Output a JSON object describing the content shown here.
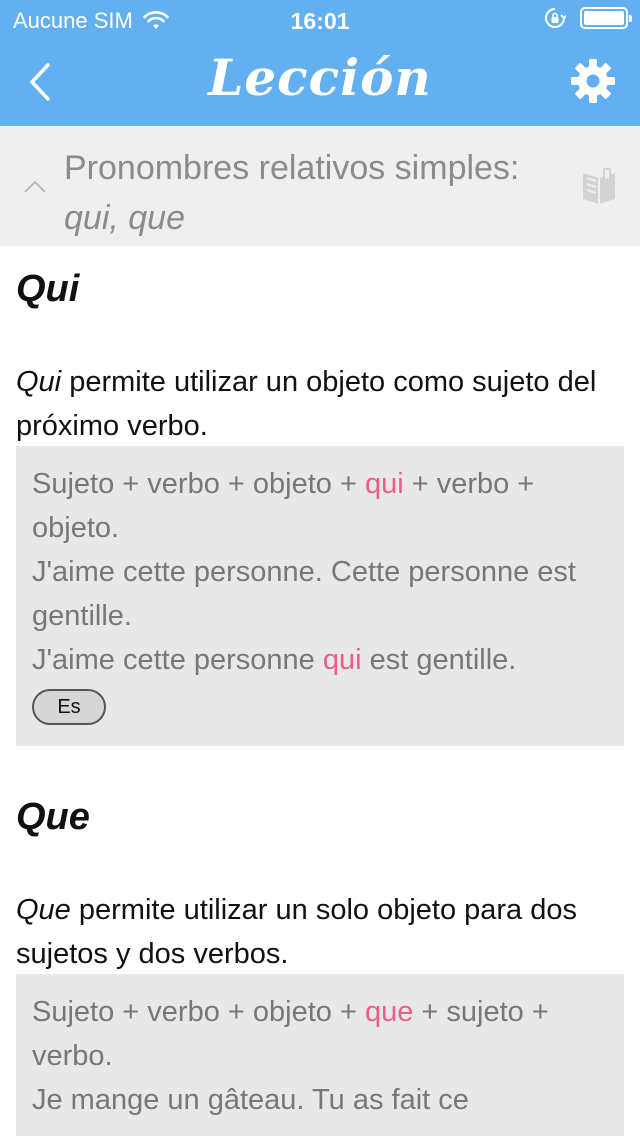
{
  "status_bar": {
    "carrier": "Aucune SIM",
    "time": "16:01"
  },
  "nav": {
    "title": "Lección"
  },
  "section": {
    "title_plain": "Pronombres relativos simples: ",
    "title_italic": "qui, que"
  },
  "lesson": {
    "qui": {
      "heading": "Qui",
      "intro_word": "Qui",
      "intro_text": " permite utilizar un objeto como sujeto del próximo verbo.",
      "example": {
        "l1_before": "Sujeto + verbo + objeto + ",
        "l1_hl": "qui",
        "l1_after": " + verbo + objeto.",
        "l2": "J'aime cette personne. Cette personne est gentille.",
        "l3_before": "J'aime cette personne ",
        "l3_hl": "qui",
        "l3_after": " est gentille.",
        "button": "Es"
      }
    },
    "que": {
      "heading": "Que",
      "intro_word": "Que",
      "intro_text": " permite utilizar un solo objeto para dos sujetos y dos verbos.",
      "example": {
        "l1_before": "Sujeto + verbo + objeto + ",
        "l1_hl": "que",
        "l1_after": " + sujeto + verbo.",
        "l2": "Je mange un gâteau. Tu as fait ce"
      }
    }
  },
  "colors": {
    "header_blue": "#62b0f0",
    "highlight_pink": "#ef5c86",
    "example_bg": "#e8e8e8",
    "section_bg": "#efefef"
  },
  "icons": [
    "wifi-icon",
    "lock-rotation-icon",
    "battery-icon",
    "back-chevron-icon",
    "gear-icon",
    "chevron-up-icon",
    "book-icon"
  ]
}
